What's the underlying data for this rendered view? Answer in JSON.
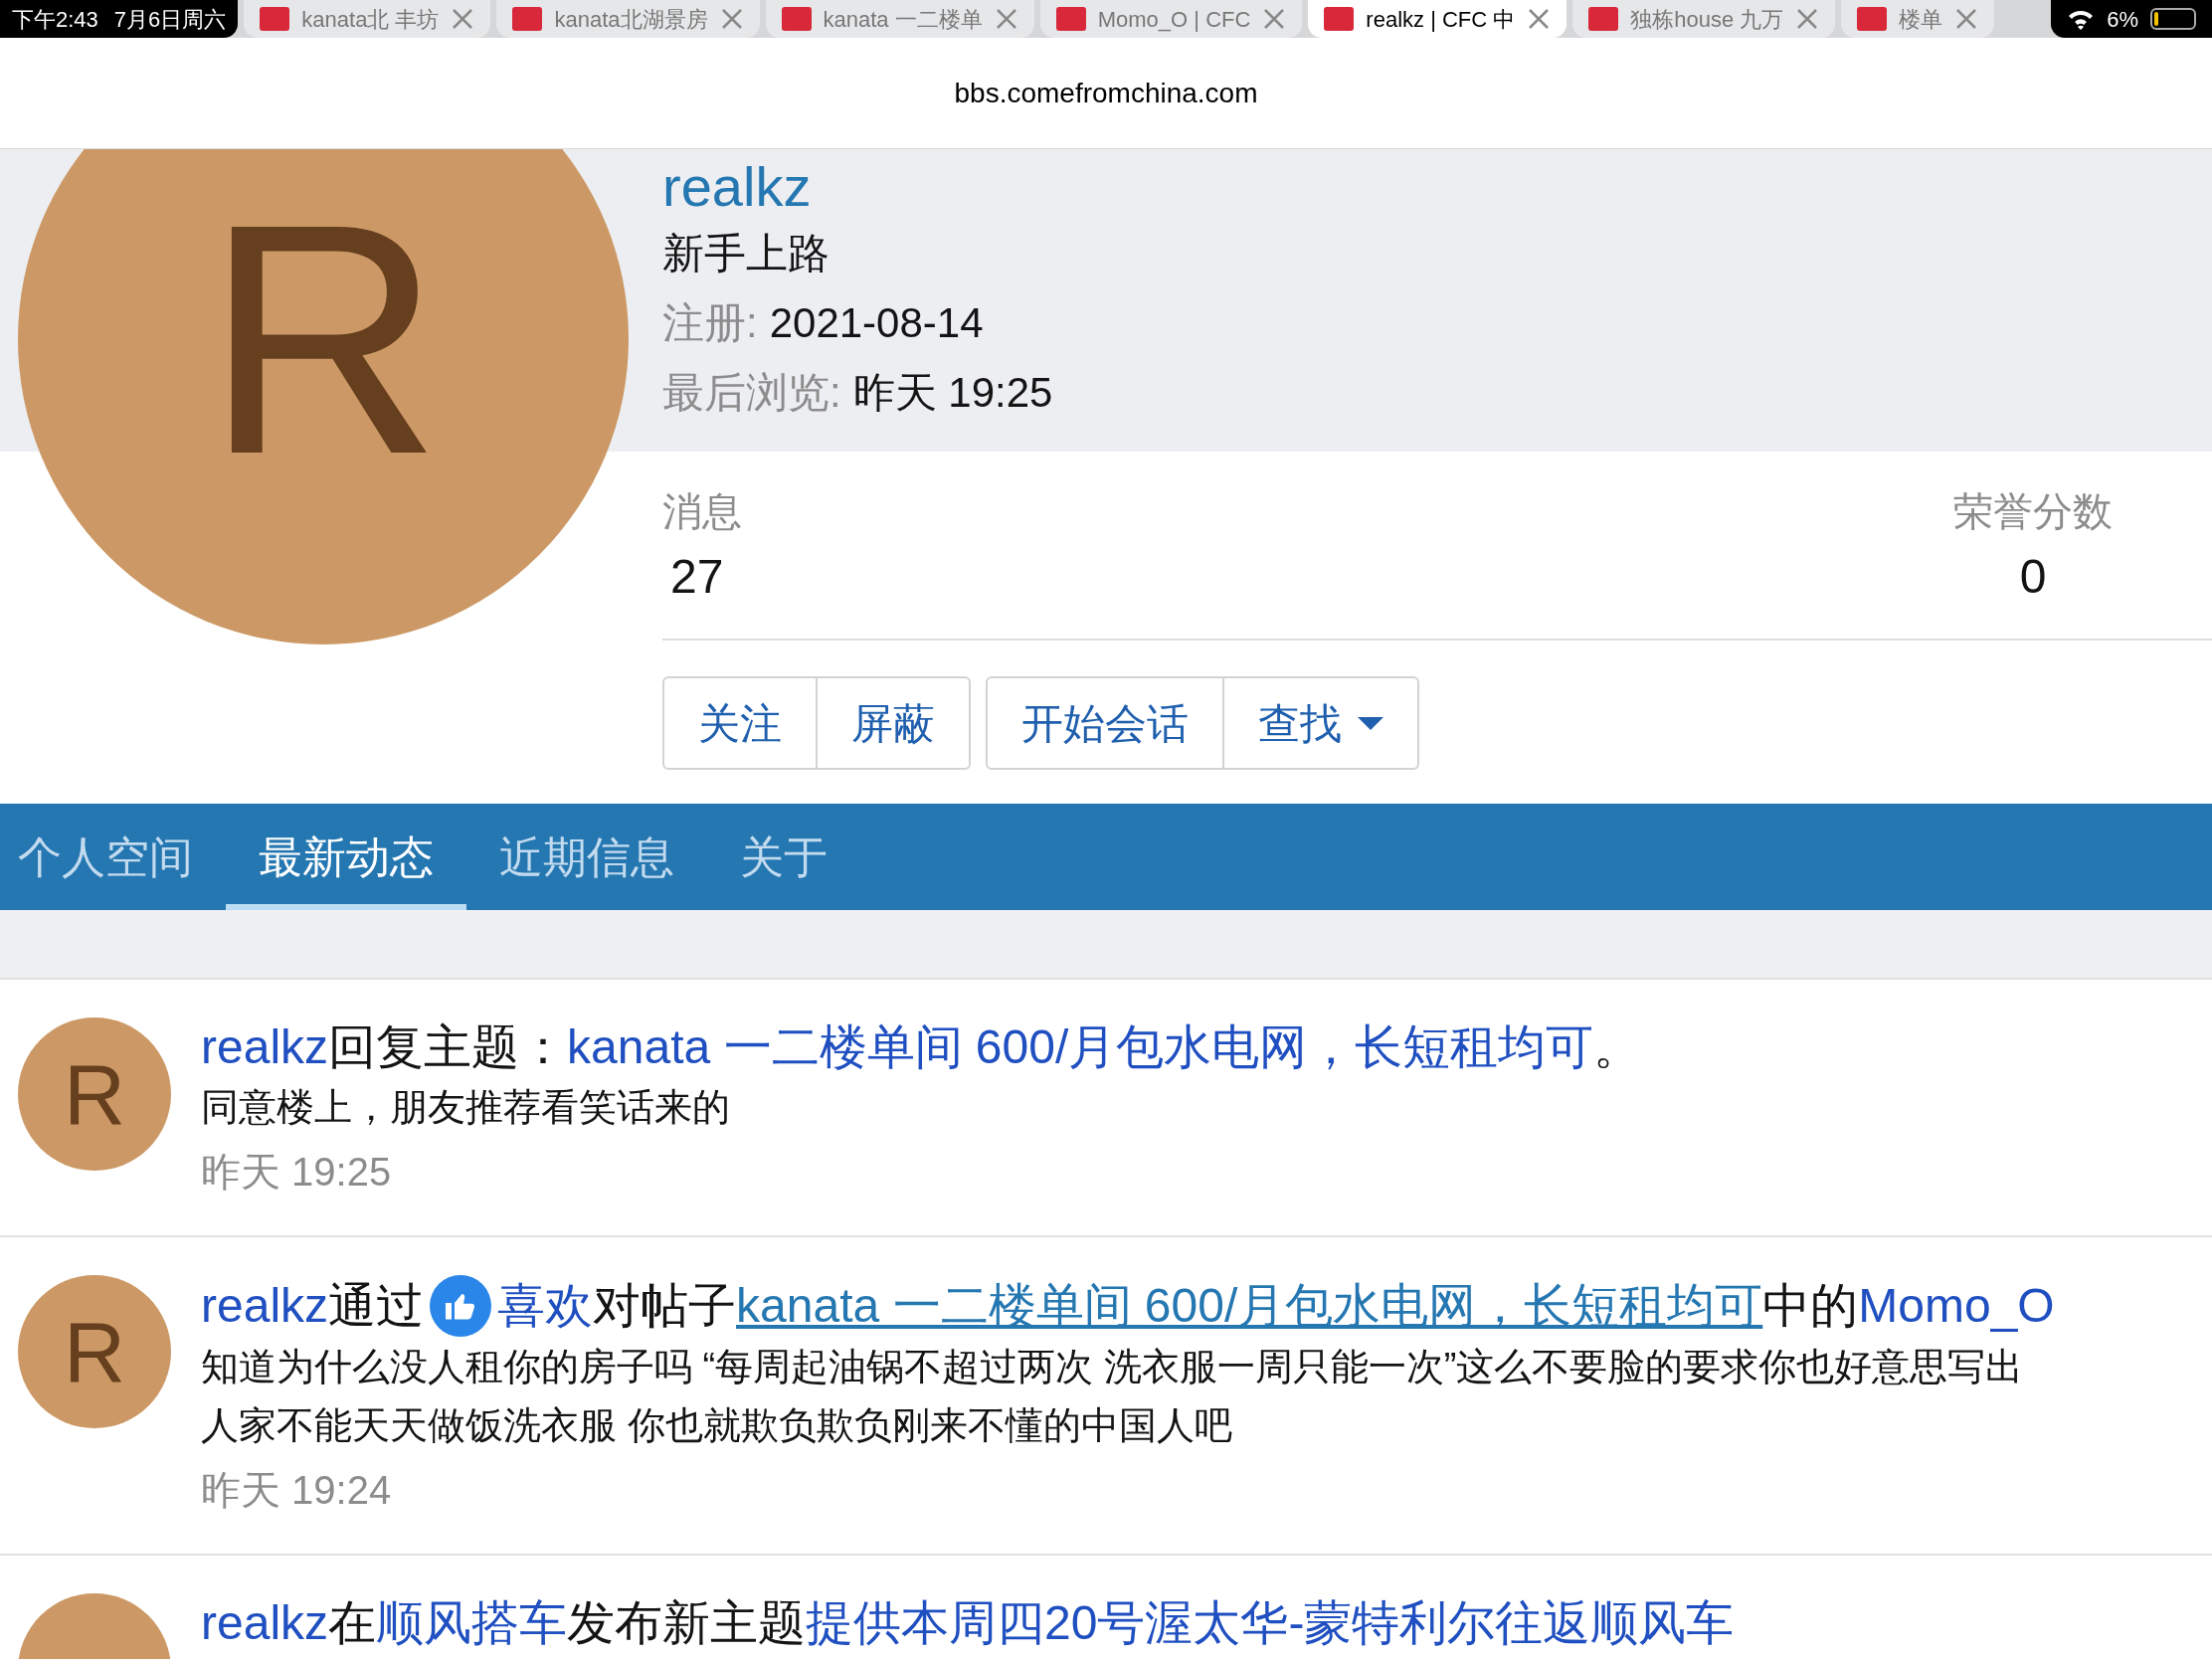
{
  "status_bar": {
    "time": "下午2:43",
    "date": "7月6日周六",
    "battery": "6%"
  },
  "browser_tabs": [
    {
      "title": "kanata北 丰坊",
      "selected": false
    },
    {
      "title": "kanata北湖景房",
      "selected": false
    },
    {
      "title": "kanata 一二楼单",
      "selected": false
    },
    {
      "title": "Momo_O | CFC",
      "selected": false
    },
    {
      "title": "realkz | CFC 中",
      "selected": true
    },
    {
      "title": "独栋house 九万",
      "selected": false
    },
    {
      "title": "楼单",
      "selected": false
    }
  ],
  "address_bar": {
    "url": "bbs.comefromchina.com"
  },
  "profile": {
    "avatar_letter": "R",
    "username": "realkz",
    "rank": "新手上路",
    "facts": [
      {
        "label": "注册:",
        "value": "2021-08-14"
      },
      {
        "label": "最后浏览:",
        "value": "昨天 19:25"
      }
    ],
    "stats": [
      {
        "label": "消息",
        "value": "27"
      },
      {
        "label": "荣誉分数",
        "value": "0"
      }
    ],
    "button_groups": [
      [
        "关注",
        "屏蔽"
      ],
      [
        "开始会话",
        "查找"
      ]
    ]
  },
  "profile_tabs": [
    {
      "label": "个人空间",
      "selected": false
    },
    {
      "label": "最新动态",
      "selected": true
    },
    {
      "label": "近期信息",
      "selected": false
    },
    {
      "label": "关于",
      "selected": false
    }
  ],
  "activity": [
    {
      "avatar_letter": "R",
      "title": [
        {
          "kind": "link",
          "text": "realkz"
        },
        {
          "kind": "text",
          "text": "回复主题："
        },
        {
          "kind": "link",
          "text": "kanata 一二楼单间 600/月包水电网，长短租均可"
        },
        {
          "kind": "text",
          "text": "。"
        }
      ],
      "body": [
        "同意楼上，朋友推荐看笑话来的"
      ],
      "time": "昨天 19:25"
    },
    {
      "avatar_letter": "R",
      "title": [
        {
          "kind": "link",
          "text": "realkz"
        },
        {
          "kind": "text",
          "text": "通过"
        },
        {
          "kind": "like"
        },
        {
          "kind": "link",
          "text": "喜欢"
        },
        {
          "kind": "text",
          "text": "对帖子"
        },
        {
          "kind": "underlined",
          "text": "kanata 一二楼单间 600/月包水电网，长短租均可"
        },
        {
          "kind": "text",
          "text": "中的 "
        },
        {
          "kind": "link",
          "text": "Momo_O"
        }
      ],
      "body": [
        "知道为什么没人租你的房子吗 “每周起油锅不超过两次 洗衣服一周只能一次”这么不要脸的要求你也好意思写出",
        "人家不能天天做饭洗衣服 你也就欺负欺负刚来不懂的中国人吧"
      ],
      "time": "昨天 19:24"
    },
    {
      "title": [
        {
          "kind": "link",
          "text": "realkz"
        },
        {
          "kind": "text",
          "text": "在"
        },
        {
          "kind": "link",
          "text": "顺风搭车"
        },
        {
          "kind": "text",
          "text": "发布新主题 "
        },
        {
          "kind": "link",
          "text": "提供本周四20号渥太华-蒙特利尔往返顺风车"
        }
      ]
    }
  ]
}
